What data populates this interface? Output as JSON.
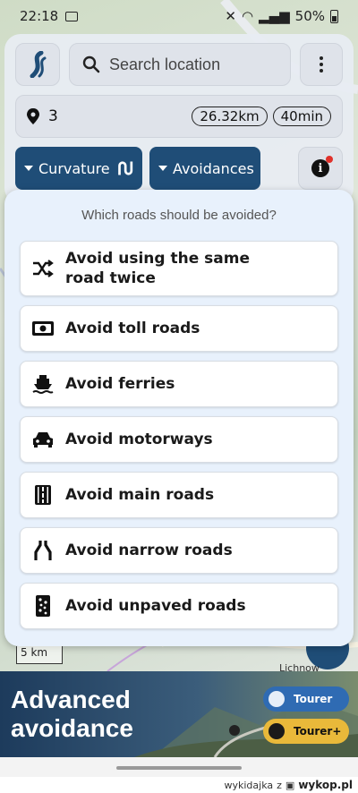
{
  "status_bar": {
    "time": "22:18",
    "battery": "50%"
  },
  "search": {
    "placeholder": "Search location"
  },
  "route": {
    "count": "3",
    "distance": "26.32km",
    "duration": "40min"
  },
  "filters": {
    "curvature_label": "Curvature",
    "avoidances_label": "Avoidances"
  },
  "popup": {
    "title": "Which roads should be avoided?",
    "options": [
      {
        "label_line1": "Avoid using the same",
        "label_line2": "road twice",
        "icon": "shuffle-icon"
      },
      {
        "label": "Avoid toll roads",
        "icon": "banknote-icon"
      },
      {
        "label": "Avoid ferries",
        "icon": "ferry-icon"
      },
      {
        "label": "Avoid motorways",
        "icon": "car-icon"
      },
      {
        "label": "Avoid main roads",
        "icon": "road-icon"
      },
      {
        "label": "Avoid narrow roads",
        "icon": "narrow-road-icon"
      },
      {
        "label": "Avoid unpaved roads",
        "icon": "unpaved-road-icon"
      }
    ]
  },
  "map": {
    "scale": "5 km",
    "place": "Lichnow"
  },
  "banner": {
    "line1": "Advanced",
    "line2": "avoidance",
    "tier1": "Tourer",
    "tier2": "Tourer+"
  },
  "footer": {
    "user": "wykidajka",
    "sep": "z",
    "site": "wykop.pl"
  },
  "colors": {
    "accent": "#1f4d77",
    "popup_bg": "#e8f1fc",
    "tier_blue": "#2f6bb3",
    "tier_gold": "#e9b93a"
  }
}
